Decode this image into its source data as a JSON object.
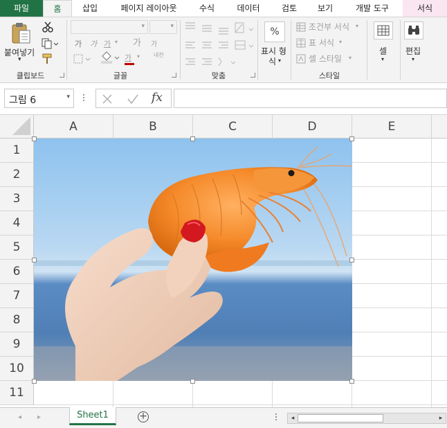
{
  "tabs": {
    "file": "파일",
    "home": "홈",
    "insert": "삽입",
    "page_layout": "페이지 레이아웃",
    "formulas": "수식",
    "data": "데이터",
    "review": "검토",
    "view": "보기",
    "developer": "개발 도구",
    "format": "서식"
  },
  "ribbon": {
    "clipboard": {
      "paste_label": "붙여넣기",
      "group_label": "클립보드"
    },
    "font": {
      "group_label": "글꼴",
      "bold_char": "가",
      "italic_char": "가",
      "underline_char": "가",
      "grow_char": "가",
      "shrink_char": "가",
      "font_color_char": "가",
      "phonetic_char": "내천"
    },
    "alignment": {
      "group_label": "맞춤"
    },
    "number": {
      "percent_symbol": "%",
      "format_label_line1": "표시 형",
      "format_label_line2": "식"
    },
    "styles": {
      "conditional_format": "조건부 서식",
      "table_format": "표 서식",
      "cell_style": "셀 스타일",
      "group_label": "스타일"
    },
    "cells": {
      "label": "셀"
    },
    "editing": {
      "label": "편집"
    }
  },
  "formula_bar": {
    "name_box_value": "그림 6",
    "fx_label": "fx",
    "formula_value": ""
  },
  "grid": {
    "columns": [
      "A",
      "B",
      "C",
      "D",
      "E"
    ],
    "rows": [
      "1",
      "2",
      "3",
      "4",
      "5",
      "6",
      "7",
      "8",
      "9",
      "10",
      "11"
    ]
  },
  "picture": {
    "name": "그림 6"
  },
  "sheets": {
    "active": "Sheet1"
  },
  "colors": {
    "excel_green": "#217346",
    "ribbon_bg": "#f3f3f3",
    "format_tab_bg": "#f9e6f0",
    "font_color_bar": "#c00000"
  }
}
